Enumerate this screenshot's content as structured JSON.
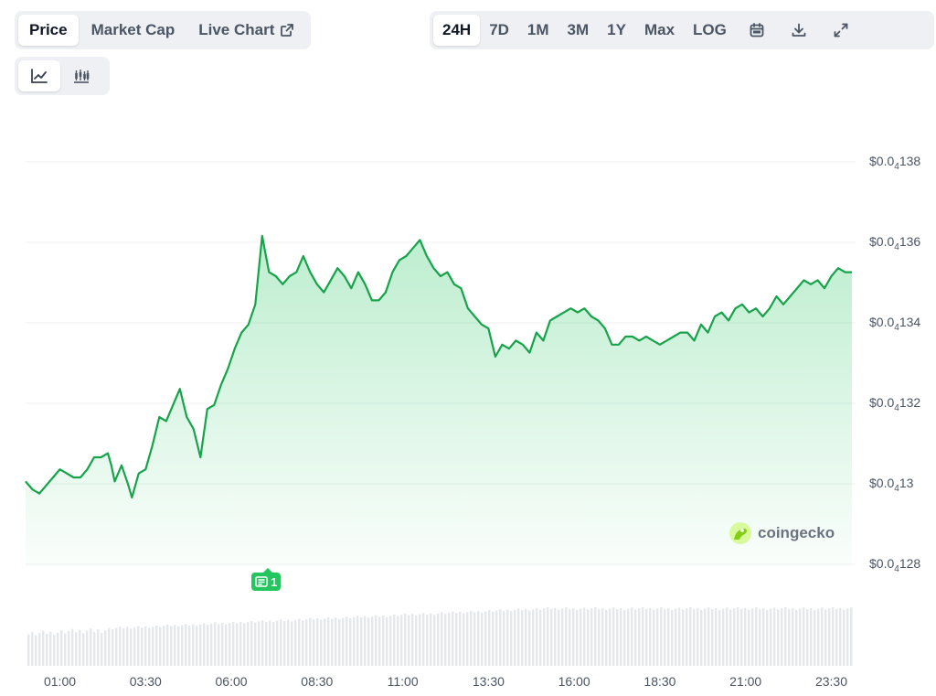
{
  "tabs": [
    {
      "label": "Price",
      "active": true
    },
    {
      "label": "Market Cap",
      "active": false
    },
    {
      "label": "Live Chart",
      "active": false
    }
  ],
  "ranges": [
    {
      "label": "24H",
      "active": true
    },
    {
      "label": "7D",
      "active": false
    },
    {
      "label": "1M",
      "active": false
    },
    {
      "label": "3M",
      "active": false
    },
    {
      "label": "1Y",
      "active": false
    },
    {
      "label": "Max",
      "active": false
    },
    {
      "label": "LOG",
      "active": false
    }
  ],
  "toolbar_icons": [
    "calendar-icon",
    "download-icon",
    "expand-icon",
    "external-link-icon",
    "line-chart-icon",
    "candlestick-icon"
  ],
  "watermark": {
    "text": "coingecko"
  },
  "news_marker": {
    "count": "1"
  },
  "colors": {
    "line": "#16a34a",
    "fill": "#22c55e",
    "volume": "#e5e7eb",
    "marker": "#22c55e",
    "grid": "#f0f1f3"
  },
  "chart_data": {
    "type": "area",
    "y_axis": {
      "position": "right",
      "ticks": [
        {
          "value": 1.38e-05,
          "prefix": "$0.0",
          "sub": "4",
          "digits": "138"
        },
        {
          "value": 1.36e-05,
          "prefix": "$0.0",
          "sub": "4",
          "digits": "136"
        },
        {
          "value": 1.34e-05,
          "prefix": "$0.0",
          "sub": "4",
          "digits": "134"
        },
        {
          "value": 1.32e-05,
          "prefix": "$0.0",
          "sub": "4",
          "digits": "132"
        },
        {
          "value": 1.3e-05,
          "prefix": "$0.0",
          "sub": "4",
          "digits": "13"
        },
        {
          "value": 1.28e-05,
          "prefix": "$0.0",
          "sub": "4",
          "digits": "128"
        }
      ],
      "ylim": [
        1.28e-05,
        1.38e-05
      ]
    },
    "x_axis": {
      "ticks": [
        {
          "label": "01:00",
          "t": 1.0
        },
        {
          "label": "03:30",
          "t": 3.5
        },
        {
          "label": "06:00",
          "t": 6.0
        },
        {
          "label": "08:30",
          "t": 8.5
        },
        {
          "label": "11:00",
          "t": 11.0
        },
        {
          "label": "13:30",
          "t": 13.5
        },
        {
          "label": "16:00",
          "t": 16.0
        },
        {
          "label": "18:30",
          "t": 18.5
        },
        {
          "label": "21:00",
          "t": 21.0
        },
        {
          "label": "23:30",
          "t": 23.5
        }
      ],
      "xlim": [
        0,
        24.1
      ]
    },
    "grid": true,
    "series": [
      {
        "points": [
          [
            0.0,
            1.299e-05
          ],
          [
            0.2,
            1.297e-05
          ],
          [
            0.4,
            1.296e-05
          ],
          [
            0.6,
            1.298e-05
          ],
          [
            0.8,
            1.3e-05
          ],
          [
            1.0,
            1.302e-05
          ],
          [
            1.2,
            1.301e-05
          ],
          [
            1.4,
            1.3e-05
          ],
          [
            1.6,
            1.3e-05
          ],
          [
            1.8,
            1.302e-05
          ],
          [
            2.0,
            1.305e-05
          ],
          [
            2.2,
            1.305e-05
          ],
          [
            2.4,
            1.306e-05
          ],
          [
            2.5,
            1.303e-05
          ],
          [
            2.6,
            1.299e-05
          ],
          [
            2.8,
            1.303e-05
          ],
          [
            3.0,
            1.298e-05
          ],
          [
            3.1,
            1.295e-05
          ],
          [
            3.3,
            1.301e-05
          ],
          [
            3.5,
            1.302e-05
          ],
          [
            3.7,
            1.308e-05
          ],
          [
            3.9,
            1.315e-05
          ],
          [
            4.1,
            1.314e-05
          ],
          [
            4.3,
            1.318e-05
          ],
          [
            4.5,
            1.322e-05
          ],
          [
            4.7,
            1.315e-05
          ],
          [
            4.9,
            1.312e-05
          ],
          [
            5.1,
            1.305e-05
          ],
          [
            5.3,
            1.317e-05
          ],
          [
            5.5,
            1.318e-05
          ],
          [
            5.7,
            1.323e-05
          ],
          [
            5.9,
            1.327e-05
          ],
          [
            6.1,
            1.332e-05
          ],
          [
            6.3,
            1.336e-05
          ],
          [
            6.5,
            1.338e-05
          ],
          [
            6.7,
            1.343e-05
          ],
          [
            6.9,
            1.36e-05
          ],
          [
            7.1,
            1.351e-05
          ],
          [
            7.3,
            1.35e-05
          ],
          [
            7.5,
            1.348e-05
          ],
          [
            7.7,
            1.35e-05
          ],
          [
            7.9,
            1.351e-05
          ],
          [
            8.1,
            1.355e-05
          ],
          [
            8.3,
            1.351e-05
          ],
          [
            8.5,
            1.348e-05
          ],
          [
            8.7,
            1.346e-05
          ],
          [
            8.9,
            1.349e-05
          ],
          [
            9.1,
            1.352e-05
          ],
          [
            9.3,
            1.35e-05
          ],
          [
            9.5,
            1.347e-05
          ],
          [
            9.7,
            1.351e-05
          ],
          [
            9.9,
            1.348e-05
          ],
          [
            10.1,
            1.344e-05
          ],
          [
            10.3,
            1.344e-05
          ],
          [
            10.5,
            1.346e-05
          ],
          [
            10.7,
            1.351e-05
          ],
          [
            10.9,
            1.354e-05
          ],
          [
            11.1,
            1.355e-05
          ],
          [
            11.3,
            1.357e-05
          ],
          [
            11.5,
            1.359e-05
          ],
          [
            11.7,
            1.355e-05
          ],
          [
            11.9,
            1.352e-05
          ],
          [
            12.1,
            1.35e-05
          ],
          [
            12.3,
            1.351e-05
          ],
          [
            12.5,
            1.348e-05
          ],
          [
            12.7,
            1.347e-05
          ],
          [
            12.9,
            1.342e-05
          ],
          [
            13.1,
            1.34e-05
          ],
          [
            13.3,
            1.338e-05
          ],
          [
            13.5,
            1.337e-05
          ],
          [
            13.7,
            1.33e-05
          ],
          [
            13.9,
            1.333e-05
          ],
          [
            14.1,
            1.332e-05
          ],
          [
            14.3,
            1.334e-05
          ],
          [
            14.5,
            1.333e-05
          ],
          [
            14.7,
            1.331e-05
          ],
          [
            14.9,
            1.336e-05
          ],
          [
            15.1,
            1.334e-05
          ],
          [
            15.3,
            1.339e-05
          ],
          [
            15.5,
            1.34e-05
          ],
          [
            15.7,
            1.341e-05
          ],
          [
            15.9,
            1.342e-05
          ],
          [
            16.1,
            1.341e-05
          ],
          [
            16.3,
            1.342e-05
          ],
          [
            16.5,
            1.34e-05
          ],
          [
            16.7,
            1.339e-05
          ],
          [
            16.9,
            1.337e-05
          ],
          [
            17.1,
            1.333e-05
          ],
          [
            17.3,
            1.333e-05
          ],
          [
            17.5,
            1.335e-05
          ],
          [
            17.7,
            1.335e-05
          ],
          [
            17.9,
            1.334e-05
          ],
          [
            18.1,
            1.335e-05
          ],
          [
            18.3,
            1.334e-05
          ],
          [
            18.5,
            1.333e-05
          ],
          [
            18.7,
            1.334e-05
          ],
          [
            18.9,
            1.335e-05
          ],
          [
            19.1,
            1.336e-05
          ],
          [
            19.3,
            1.336e-05
          ],
          [
            19.5,
            1.334e-05
          ],
          [
            19.7,
            1.338e-05
          ],
          [
            19.9,
            1.336e-05
          ],
          [
            20.1,
            1.34e-05
          ],
          [
            20.3,
            1.341e-05
          ],
          [
            20.5,
            1.339e-05
          ],
          [
            20.7,
            1.342e-05
          ],
          [
            20.9,
            1.343e-05
          ],
          [
            21.1,
            1.341e-05
          ],
          [
            21.3,
            1.342e-05
          ],
          [
            21.5,
            1.34e-05
          ],
          [
            21.7,
            1.342e-05
          ],
          [
            21.9,
            1.345e-05
          ],
          [
            22.1,
            1.343e-05
          ],
          [
            22.3,
            1.345e-05
          ],
          [
            22.5,
            1.347e-05
          ],
          [
            22.7,
            1.349e-05
          ],
          [
            22.9,
            1.348e-05
          ],
          [
            23.1,
            1.349e-05
          ],
          [
            23.3,
            1.347e-05
          ],
          [
            23.5,
            1.35e-05
          ],
          [
            23.7,
            1.352e-05
          ],
          [
            23.9,
            1.351e-05
          ],
          [
            24.1,
            1.351e-05
          ]
        ]
      }
    ]
  }
}
